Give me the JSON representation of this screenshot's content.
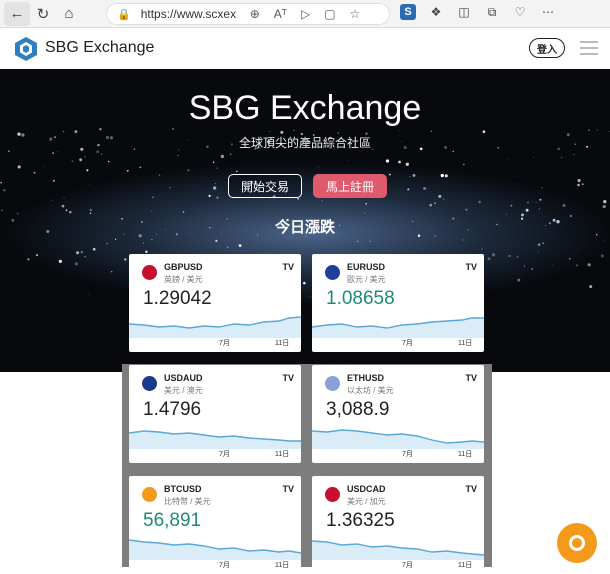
{
  "browser": {
    "url": "https://www.scxex...",
    "read_aloud_label": "Aᵀ"
  },
  "header": {
    "logo_text": "SBG Exchange",
    "login_label": "登入"
  },
  "hero": {
    "title": "SBG Exchange",
    "subtitle": "全球頂尖的產品綜合社區",
    "start_label": "開始交易",
    "register_label": "馬上註冊",
    "section_title": "今日漲跌"
  },
  "cards": [
    {
      "symbol": "GBPUSD",
      "name": "英鎊 / 美元",
      "price": "1.29042",
      "price_color": "#222222",
      "axis": [
        "7月",
        "11日"
      ],
      "flag_color": "#c8102e"
    },
    {
      "symbol": "EURUSD",
      "name": "歐元 / 美元",
      "price": "1.08658",
      "price_color": "#1e8a78",
      "axis": [
        "7月",
        "11日"
      ],
      "flag_color": "#1f3f9a"
    },
    {
      "symbol": "USDAUD",
      "name": "美元 / 澳元",
      "price": "1.4796",
      "price_color": "#222222",
      "axis": [
        "7月",
        "11日"
      ],
      "flag_color": "#1a3a8a"
    },
    {
      "symbol": "ETHUSD",
      "name": "以太坊 / 美元",
      "price": "3,088.9",
      "price_color": "#222222",
      "axis": [
        "7月",
        "11日"
      ],
      "flag_color": "#8aa0d8"
    },
    {
      "symbol": "BTCUSD",
      "name": "比特幣 / 美元",
      "price": "56,891",
      "price_color": "#1e8a78",
      "axis": [
        "7月",
        "11日"
      ],
      "flag_color": "#f39a1a"
    },
    {
      "symbol": "USDCAD",
      "name": "美元 / 加元",
      "price": "1.36325",
      "price_color": "#222222",
      "axis": [
        "7月",
        "11日"
      ],
      "flag_color": "#c8102e"
    }
  ],
  "tradingview_label": "TV",
  "colors": {
    "accent": "#e05a6e",
    "positive": "#1e8a78",
    "chart_line": "#5aa7d8",
    "chat": "#f39a1a"
  }
}
